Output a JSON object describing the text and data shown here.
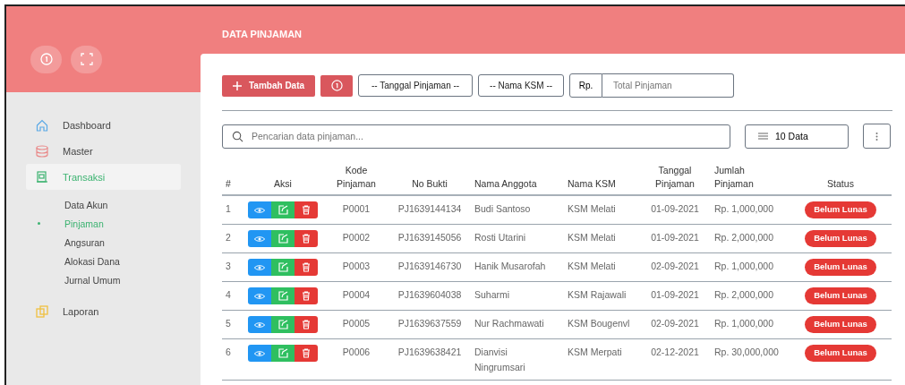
{
  "page_title": "DATA PINJAMAN",
  "sidebar": {
    "items": [
      {
        "label": "Dashboard",
        "selected": false
      },
      {
        "label": "Master",
        "selected": false
      },
      {
        "label": "Transaksi",
        "selected": true,
        "children": [
          {
            "label": "Data Akun",
            "selected": false
          },
          {
            "label": "Pinjaman",
            "selected": true
          },
          {
            "label": "Angsuran",
            "selected": false
          },
          {
            "label": "Alokasi Dana",
            "selected": false
          },
          {
            "label": "Jurnal Umum",
            "selected": false
          }
        ]
      },
      {
        "label": "Laporan",
        "selected": false
      }
    ]
  },
  "toolbar": {
    "add_button": "Tambah Data",
    "date_filter": "-- Tanggal Pinjaman --",
    "ksm_filter": "-- Nama KSM --",
    "amount_prefix": "Rp.",
    "amount_placeholder": "Total Pinjaman"
  },
  "search": {
    "placeholder": "Pencarian data pinjaman..."
  },
  "page_size": "10 Data",
  "table": {
    "columns": [
      "#",
      "Aksi",
      "Kode Pinjaman",
      "No Bukti",
      "Nama Anggota",
      "Nama KSM",
      "Tanggal Pinjaman",
      "Jumlah Pinjaman",
      "Status"
    ],
    "rows": [
      {
        "no": "1",
        "kode": "P0001",
        "bukti": "PJ1639144134",
        "anggota": "Budi Santoso",
        "ksm": "KSM Melati",
        "tanggal": "01-09-2021",
        "jumlah": "Rp. 1,000,000",
        "status": "Belum Lunas"
      },
      {
        "no": "2",
        "kode": "P0002",
        "bukti": "PJ1639145056",
        "anggota": "Rosti Utarini",
        "ksm": "KSM Melati",
        "tanggal": "01-09-2021",
        "jumlah": "Rp. 2,000,000",
        "status": "Belum Lunas"
      },
      {
        "no": "3",
        "kode": "P0003",
        "bukti": "PJ1639146730",
        "anggota": "Hanik Musarofah",
        "ksm": "KSM Melati",
        "tanggal": "02-09-2021",
        "jumlah": "Rp. 1,000,000",
        "status": "Belum Lunas"
      },
      {
        "no": "4",
        "kode": "P0004",
        "bukti": "PJ1639604038",
        "anggota": "Suharmi",
        "ksm": "KSM Rajawali",
        "tanggal": "01-09-2021",
        "jumlah": "Rp. 2,000,000",
        "status": "Belum Lunas"
      },
      {
        "no": "5",
        "kode": "P0005",
        "bukti": "PJ1639637559",
        "anggota": "Nur Rachmawati",
        "ksm": "KSM Bougenvl",
        "tanggal": "02-09-2021",
        "jumlah": "Rp. 1,000,000",
        "status": "Belum Lunas"
      },
      {
        "no": "6",
        "kode": "P0006",
        "bukti": "PJ1639638421",
        "anggota": "Dianvisi Ningrumsari",
        "ksm": "KSM Merpati",
        "tanggal": "02-12-2021",
        "jumlah": "Rp. 30,000,000",
        "status": "Belum Lunas"
      }
    ]
  }
}
